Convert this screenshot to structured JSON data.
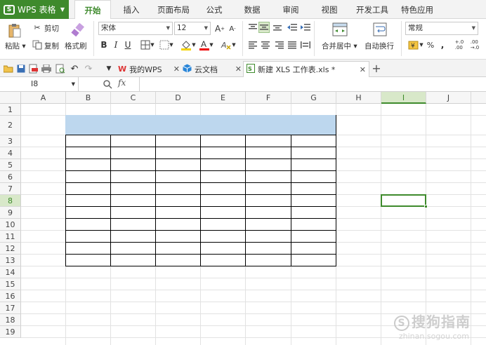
{
  "app": {
    "name": "WPS 表格",
    "logo_letter": "S"
  },
  "menu_tabs": [
    "开始",
    "插入",
    "页面布局",
    "公式",
    "数据",
    "审阅",
    "视图",
    "开发工具",
    "特色应用"
  ],
  "ribbon": {
    "paste": "粘贴",
    "cut": "剪切",
    "copy": "复制",
    "format_painter": "格式刷",
    "font_name": "宋体",
    "font_size": "12",
    "bold": "B",
    "italic": "I",
    "underline": "U",
    "merge_center": "合并居中",
    "wrap_text": "自动换行",
    "number_format": "常规",
    "percent": "%",
    "comma": ",",
    "inc_decimal": "+.0\n.00",
    "dec_decimal": ".00\n→.0"
  },
  "doc_tabs": [
    {
      "label": "我的WPS"
    },
    {
      "label": "云文档"
    },
    {
      "label": "新建 XLS 工作表.xls *"
    }
  ],
  "formula_bar": {
    "cell_ref": "I8",
    "fx": "fx",
    "content": ""
  },
  "columns": [
    "A",
    "B",
    "C",
    "D",
    "E",
    "F",
    "G",
    "H",
    "I",
    "J"
  ],
  "rows": [
    "1",
    "2",
    "3",
    "4",
    "5",
    "6",
    "7",
    "8",
    "9",
    "10",
    "11",
    "12",
    "13",
    "14",
    "15",
    "16",
    "17",
    "18",
    "19"
  ],
  "selected_cell": "I8",
  "colors": {
    "accent": "#3e8a2c",
    "header_fill": "#bdd7ee"
  },
  "watermark": {
    "text": "搜狗指南",
    "url_text": "zhinan.sogou.com"
  }
}
